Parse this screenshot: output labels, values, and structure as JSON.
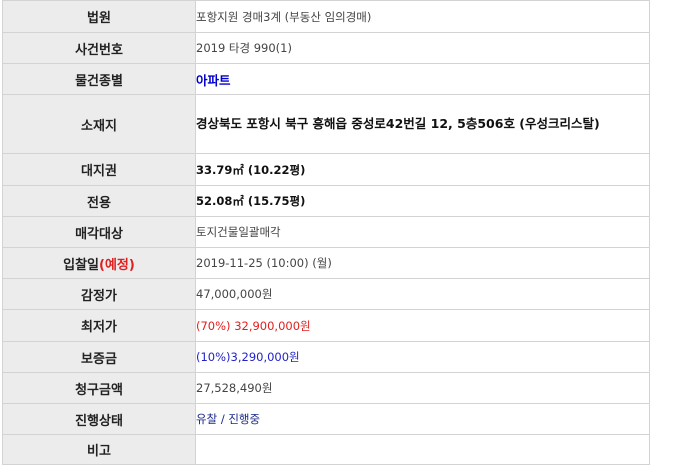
{
  "rows": {
    "court": {
      "label": "법원",
      "value": "포항지원  경매3계 (부동산 임의경매)"
    },
    "case_no": {
      "label": "사건번호",
      "value": "2019 타경 990(1)"
    },
    "property_type": {
      "label": "물건종별",
      "value": "아파트"
    },
    "location": {
      "label": "소재지",
      "value": "경상북도 포항시 북구 흥해읍 중성로42번길 12, 5층506호 (우성크리스탈)"
    },
    "land_right": {
      "label": "대지권",
      "value": "33.79㎡ (10.22평)"
    },
    "exclusive": {
      "label": "전용",
      "value": "52.08㎡ (15.75평)"
    },
    "sale_target": {
      "label": "매각대상",
      "value": "토지건물일괄매각"
    },
    "bid_date": {
      "label": "입찰일",
      "label_suffix": "(예정)",
      "value": "2019-11-25 (10:00) (월)"
    },
    "appraisal": {
      "label": "감정가",
      "value": "47,000,000원"
    },
    "minimum": {
      "label": "최저가",
      "value": "(70%) 32,900,000원"
    },
    "deposit": {
      "label": "보증금",
      "value": "(10%)3,290,000원"
    },
    "claim": {
      "label": "청구금액",
      "value": "27,528,490원"
    },
    "status": {
      "label": "진행상태",
      "value": "유찰 / 진행중"
    },
    "remarks": {
      "label": "비고",
      "value": ""
    }
  },
  "colors": {
    "label_bg": "#ececec",
    "border": "#d3d3d3",
    "red": "#e02020",
    "blue": "#2222cc"
  }
}
